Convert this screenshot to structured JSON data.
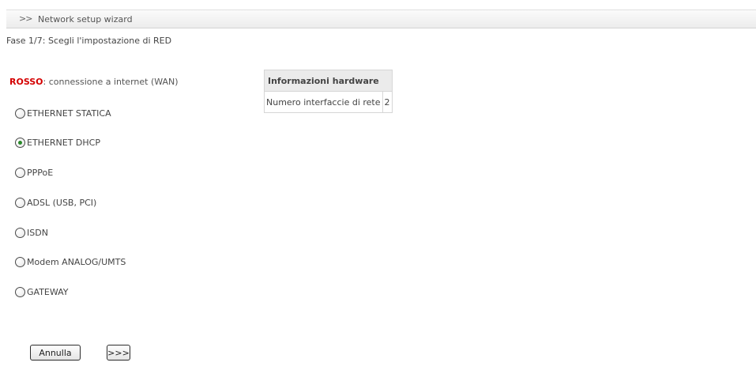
{
  "header": {
    "chevron": ">>",
    "title": "Network setup wizard"
  },
  "step": {
    "title": "Fase 1/7: Scegli l'impostazione di RED"
  },
  "red_zone": {
    "label": "ROSSO",
    "separator": ":",
    "description": " connessione a internet (WAN)",
    "label_color": "#d40000"
  },
  "options": [
    {
      "label": "ETHERNET STATICA",
      "checked": false
    },
    {
      "label": "ETHERNET DHCP",
      "checked": true
    },
    {
      "label": "PPPoE",
      "checked": false
    },
    {
      "label": "ADSL (USB, PCI)",
      "checked": false
    },
    {
      "label": "ISDN",
      "checked": false
    },
    {
      "label": "Modem ANALOG/UMTS",
      "checked": false
    },
    {
      "label": "GATEWAY",
      "checked": false
    }
  ],
  "hardware": {
    "heading": "Informazioni hardware",
    "rows": [
      {
        "label": "Numero interfaccie di rete",
        "value": "2"
      }
    ]
  },
  "buttons": {
    "cancel": "Annulla",
    "next": ">>>"
  },
  "colors": {
    "selected_radio": "#2a8a2a",
    "red_label": "#d40000"
  }
}
